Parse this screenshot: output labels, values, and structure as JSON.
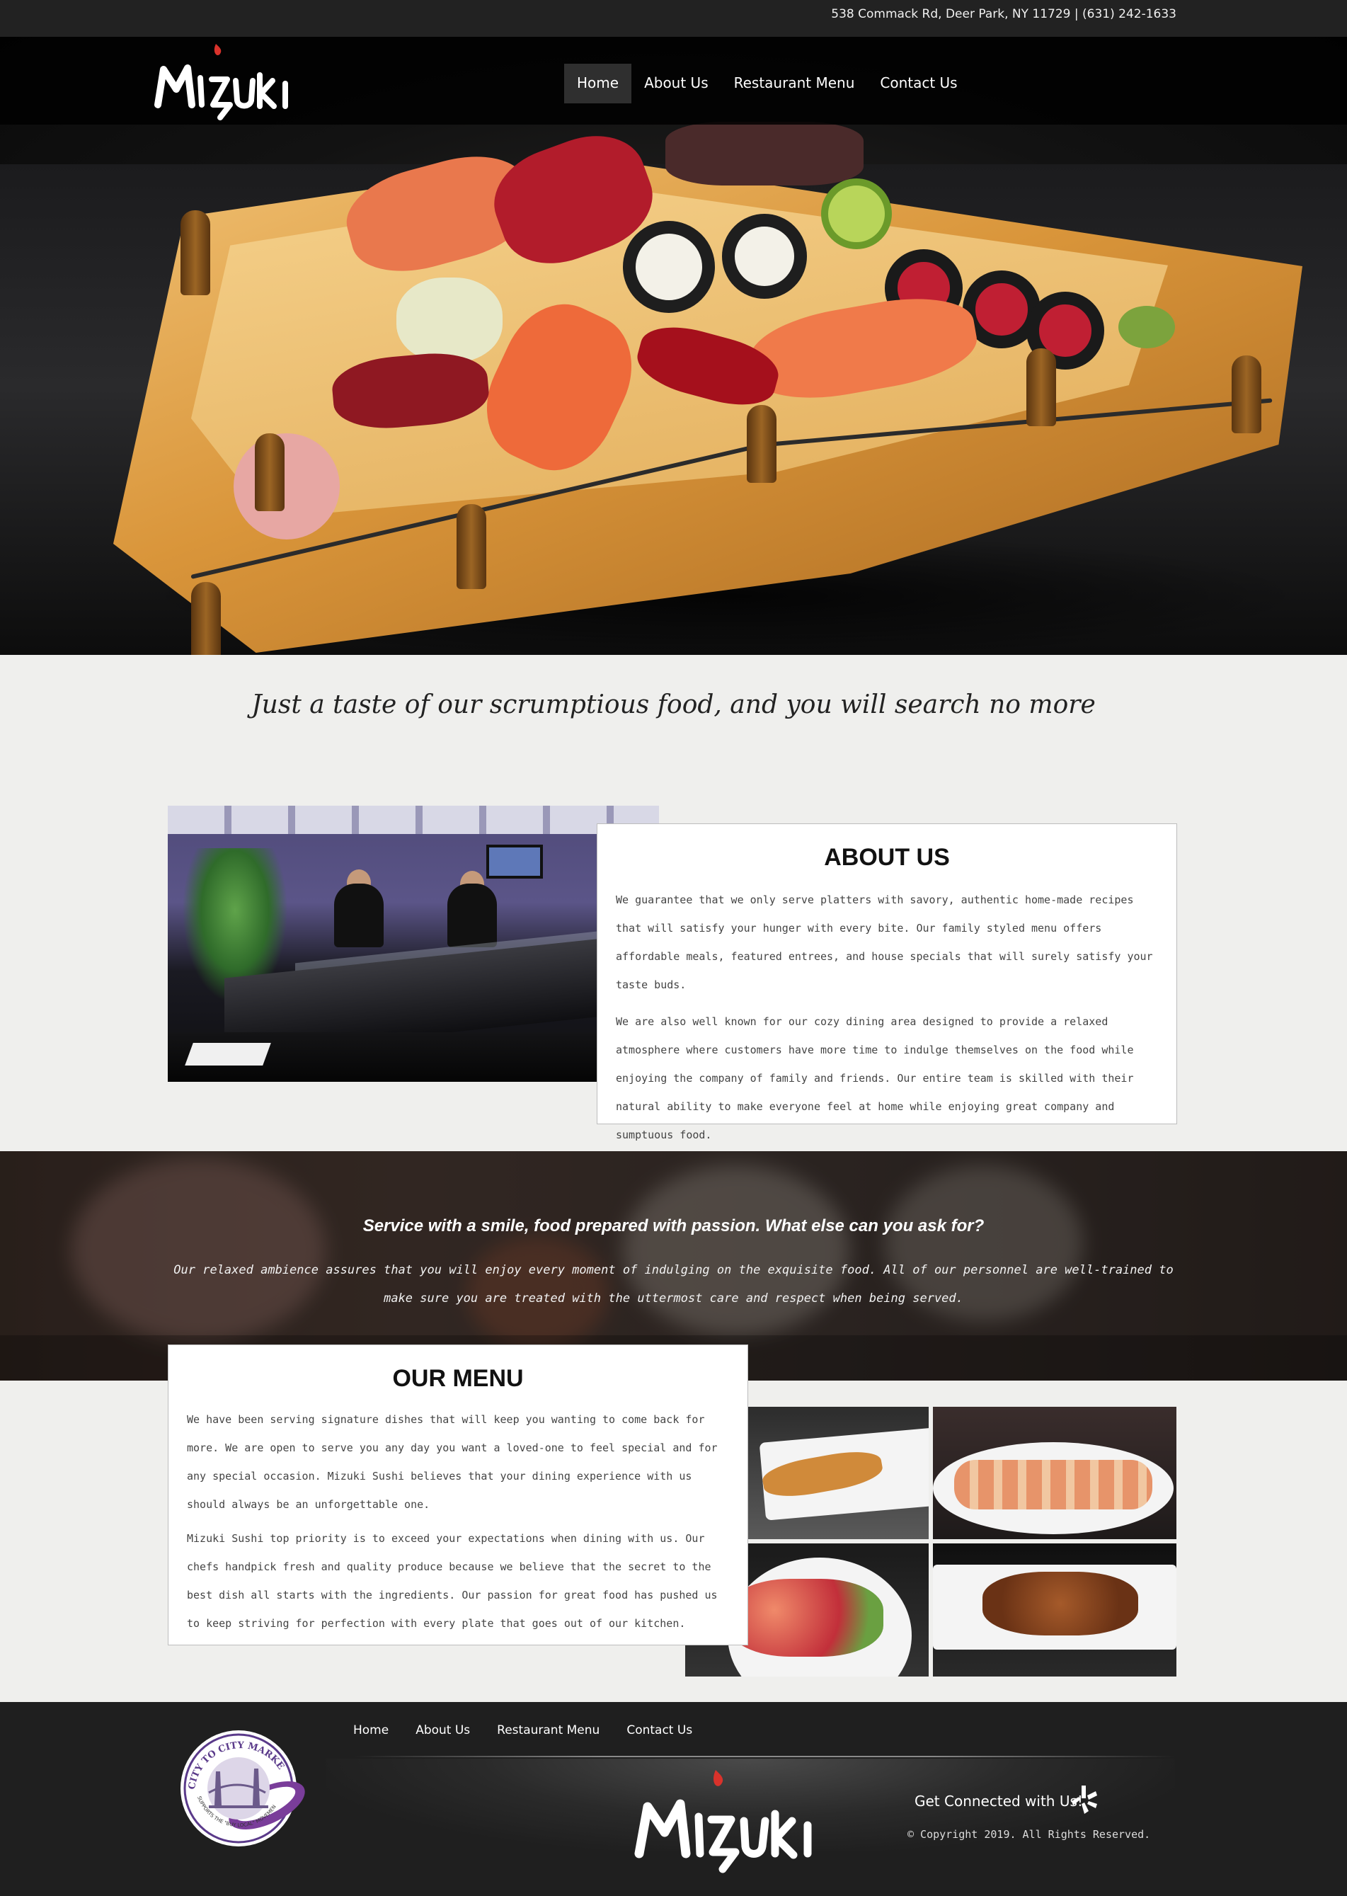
{
  "topbar": {
    "address": "538 Commack Rd, Deer Park, NY 11729 | (631) 242-1633"
  },
  "brand": {
    "logo_text": "Mizuki",
    "accent": "#d9322b"
  },
  "nav": {
    "items": [
      {
        "label": "Home",
        "active": true
      },
      {
        "label": "About Us",
        "active": false
      },
      {
        "label": "Restaurant Menu",
        "active": false
      },
      {
        "label": "Contact Us",
        "active": false
      }
    ]
  },
  "tagline": "Just a taste of our scrumptious food, and you will search no more",
  "about": {
    "title": "ABOUT US",
    "paragraphs": [
      "We guarantee that we only serve platters with savory, authentic home-made recipes that will satisfy your hunger with every bite. Our family styled menu offers affordable meals, featured entrees, and house specials that will surely satisfy your taste buds.",
      "We are also well known for our cozy dining area designed to provide a relaxed atmosphere where customers have more time to indulge themselves on the food while enjoying the company of family and friends. Our entire team is skilled with their natural ability to make everyone feel at home while enjoying great company and sumptuous food."
    ]
  },
  "band": {
    "heading": "Service with a smile, food prepared with passion. What else can you ask for?",
    "text": "Our relaxed ambience assures that you will enjoy every moment of indulging on the exquisite food. All of our personnel are well-trained to make sure you are treated with the uttermost care and respect when being served."
  },
  "menu": {
    "title": "OUR MENU",
    "paragraphs": [
      "We have been serving signature dishes that will keep you wanting to come back for more. We are open to serve you any day you want a loved-one to feel special and for any special occasion. Mizuki Sushi believes that your dining experience with us should always be an unforgettable one.",
      "Mizuki Sushi top priority is to exceed your expectations when dining with us. Our chefs handpick fresh and quality produce because we believe that the secret to the best dish all starts with the ingredients. Our passion for great food has pushed us to keep striving for perfection with every plate that goes out of our kitchen."
    ]
  },
  "footer": {
    "nav": [
      "Home",
      "About Us",
      "Restaurant Menu",
      "Contact Us"
    ],
    "badge_text": "CITY TO CITY MARKET",
    "badge_subtext": "SUPPORTS THE \"BUY LOCAL\" MOVEMENT",
    "connect": "Get Connected with Us!",
    "copyright": "© Copyright 2019. All Rights Reserved."
  }
}
